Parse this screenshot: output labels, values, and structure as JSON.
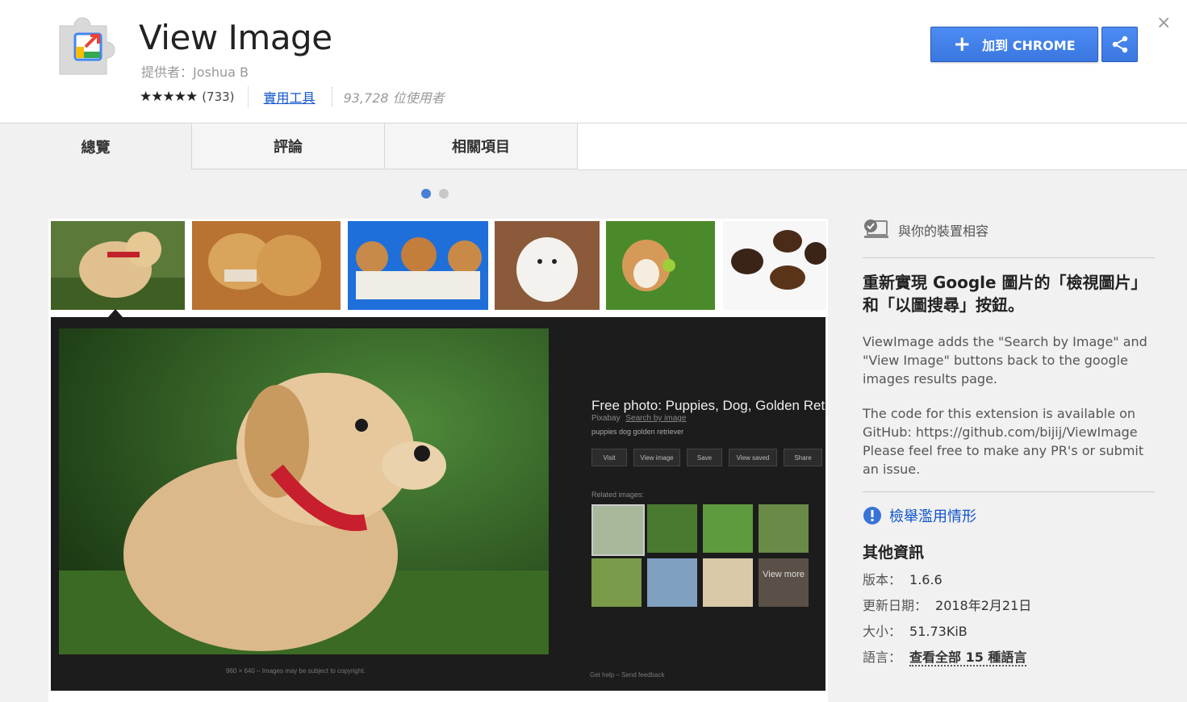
{
  "header": {
    "title": "View Image",
    "provider": "提供者：Joshua B",
    "stars": "★★★★★",
    "rating_count": "(733)",
    "category": "實用工具",
    "users": "93,728 位使用者",
    "add_button_label": "加到 CHROME",
    "add_button_icon": "plus-icon",
    "share_icon": "share-icon",
    "close_icon": "close-icon",
    "close_glyph": "×"
  },
  "tabs": [
    {
      "label": "總覽",
      "active": true
    },
    {
      "label": "評論",
      "active": false
    },
    {
      "label": "相關項目",
      "active": false
    }
  ],
  "carousel": {
    "dots": 2,
    "active_dot": 1
  },
  "screenshot": {
    "title": "Free photo: Puppies, Dog, Golden Retr…",
    "source": "Pixabay",
    "search_link": "Search by image",
    "tags": "puppies dog golden retriever",
    "buttons": [
      "Visit",
      "View image",
      "Save",
      "View saved",
      "Share"
    ],
    "related_label": "Related images:",
    "view_more": "View more",
    "footer_left": "960 × 640 – Images may be subject to copyright.",
    "footer_right": "Get help – Send feedback"
  },
  "sidebar": {
    "compat": "與你的裝置相容",
    "headline": "重新實現 Google 圖片的「檢視圖片」和「以圖搜尋」按鈕。",
    "description_1": "ViewImage adds the \"Search by Image\" and \"View Image\" buttons back to the google images results page.",
    "description_2": "The code for this extension is available on GitHub: https://github.com/bijij/ViewImage Please feel free to make any PR's or submit an issue.",
    "report": "檢舉濫用情形",
    "info_title": "其他資訊",
    "version_label": "版本：",
    "version": "1.6.6",
    "updated_label": "更新日期：",
    "updated": "2018年2月21日",
    "size_label": "大小：",
    "size": "51.73KiB",
    "language_label": "語言：",
    "language": "查看全部 15 種語言"
  },
  "colors": {
    "accent": "#4a7fd8",
    "link": "#1155cc",
    "button": "#3a77e0"
  }
}
